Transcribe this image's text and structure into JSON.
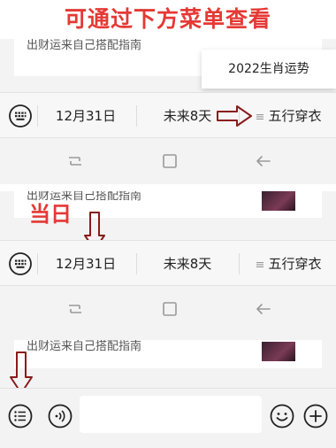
{
  "annotations": {
    "top_hint": "可通过下方菜单查看",
    "today_hint": "当日"
  },
  "card": {
    "partial_text": "出财运来自己搭配指南"
  },
  "popup": {
    "item": "2022生肖运势"
  },
  "menu": {
    "date_label": "12月31日",
    "future_label": "未来8天",
    "wuxing_glyph": "≡",
    "wuxing_label": "五行穿衣"
  },
  "input": {
    "value": "",
    "placeholder": ""
  },
  "icons": [
    "keyboard-icon",
    "recent-apps-icon",
    "home-icon",
    "back-icon",
    "menu-list-icon",
    "voice-icon",
    "emoji-icon",
    "plus-icon",
    "arrow-right-icon",
    "arrow-down-icon"
  ],
  "colors": {
    "annotation_red": "#e53935",
    "arrow_dark_red": "#8b1a1a",
    "bar_bg": "#f7f7f7",
    "panel_bg": "#f3f3f3"
  }
}
